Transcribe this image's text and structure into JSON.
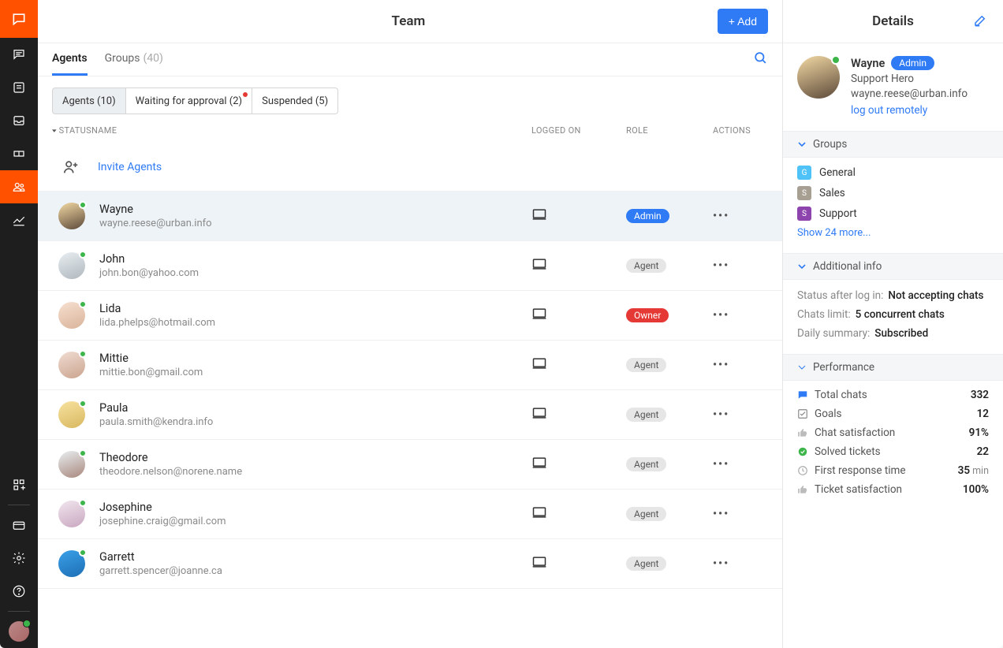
{
  "colors": {
    "accent": "#ff5100",
    "primary": "#2f7bf5",
    "success": "#3cb54a",
    "danger": "#e53935"
  },
  "header": {
    "team_title": "Team",
    "add_button": "+ Add",
    "details_title": "Details"
  },
  "tabs": {
    "agents_label": "Agents",
    "groups_label": "Groups",
    "groups_count": "(40)"
  },
  "filters": {
    "agents": "Agents (10)",
    "waiting": "Waiting for approval (2)",
    "suspended": "Suspended (5)"
  },
  "table": {
    "col_status": "STATUS",
    "col_name": "NAME",
    "col_logged": "LOGGED ON",
    "col_role": "ROLE",
    "col_actions": "ACTIONS",
    "invite_label": "Invite Agents"
  },
  "agents": [
    {
      "name": "Wayne",
      "email": "wayne.reese@urban.info",
      "role": "Admin",
      "role_class": "admin",
      "selected": true,
      "avatar_bg": "linear-gradient(160deg,#f3d9a4,#5c4939)"
    },
    {
      "name": "John",
      "email": "john.bon@yahoo.com",
      "role": "Agent",
      "role_class": "agent",
      "selected": false,
      "avatar_bg": "linear-gradient(160deg,#e8eef1,#b0b8be)"
    },
    {
      "name": "Lida",
      "email": "lida.phelps@hotmail.com",
      "role": "Owner",
      "role_class": "owner",
      "selected": false,
      "avatar_bg": "linear-gradient(160deg,#f7e0d0,#d9b39a)"
    },
    {
      "name": "Mittie",
      "email": "mittie.bon@gmail.com",
      "role": "Agent",
      "role_class": "agent",
      "selected": false,
      "avatar_bg": "linear-gradient(160deg,#f0dcd2,#cba48f)"
    },
    {
      "name": "Paula",
      "email": "paula.smith@kendra.info",
      "role": "Agent",
      "role_class": "agent",
      "selected": false,
      "avatar_bg": "linear-gradient(160deg,#f8e2a0,#d8b860)"
    },
    {
      "name": "Theodore",
      "email": "theodore.nelson@norene.name",
      "role": "Agent",
      "role_class": "agent",
      "selected": false,
      "avatar_bg": "linear-gradient(160deg,#e8eef1,#a9887d)"
    },
    {
      "name": "Josephine",
      "email": "josephine.craig@gmail.com",
      "role": "Agent",
      "role_class": "agent",
      "selected": false,
      "avatar_bg": "linear-gradient(160deg,#f1e6ee,#c9a7c0)"
    },
    {
      "name": "Garrett",
      "email": "garrett.spencer@joanne.ca",
      "role": "Agent",
      "role_class": "agent",
      "selected": false,
      "avatar_bg": "linear-gradient(160deg,#3aa0e8,#1e6fb5)"
    }
  ],
  "details": {
    "name": "Wayne",
    "badge": "Admin",
    "title": "Support Hero",
    "email": "wayne.reese@urban.info",
    "logout": "log out remotely",
    "sections": {
      "groups": "Groups",
      "additional": "Additional info",
      "performance": "Performance"
    },
    "groups": [
      {
        "label": "General",
        "icon": "G",
        "cls": "g"
      },
      {
        "label": "Sales",
        "icon": "S",
        "cls": "s"
      },
      {
        "label": "Support",
        "icon": "S",
        "cls": "p"
      }
    ],
    "show_more": "Show 24 more...",
    "info": {
      "status_key": "Status after log in:",
      "status_val": "Not accepting chats",
      "limit_key": "Chats limit:",
      "limit_val": "5 concurrent chats",
      "summary_key": "Daily summary:",
      "summary_val": "Subscribed"
    },
    "performance": [
      {
        "icon": "chat",
        "label": "Total chats",
        "value": "332",
        "unit": ""
      },
      {
        "icon": "check",
        "label": "Goals",
        "value": "12",
        "unit": ""
      },
      {
        "icon": "thumb",
        "label": "Chat satisfaction",
        "value": "91%",
        "unit": ""
      },
      {
        "icon": "circle",
        "label": "Solved tickets",
        "value": "22",
        "unit": ""
      },
      {
        "icon": "clock",
        "label": "First response time",
        "value": "35",
        "unit": "min"
      },
      {
        "icon": "thumb",
        "label": "Ticket satisfaction",
        "value": "100%",
        "unit": ""
      }
    ]
  }
}
